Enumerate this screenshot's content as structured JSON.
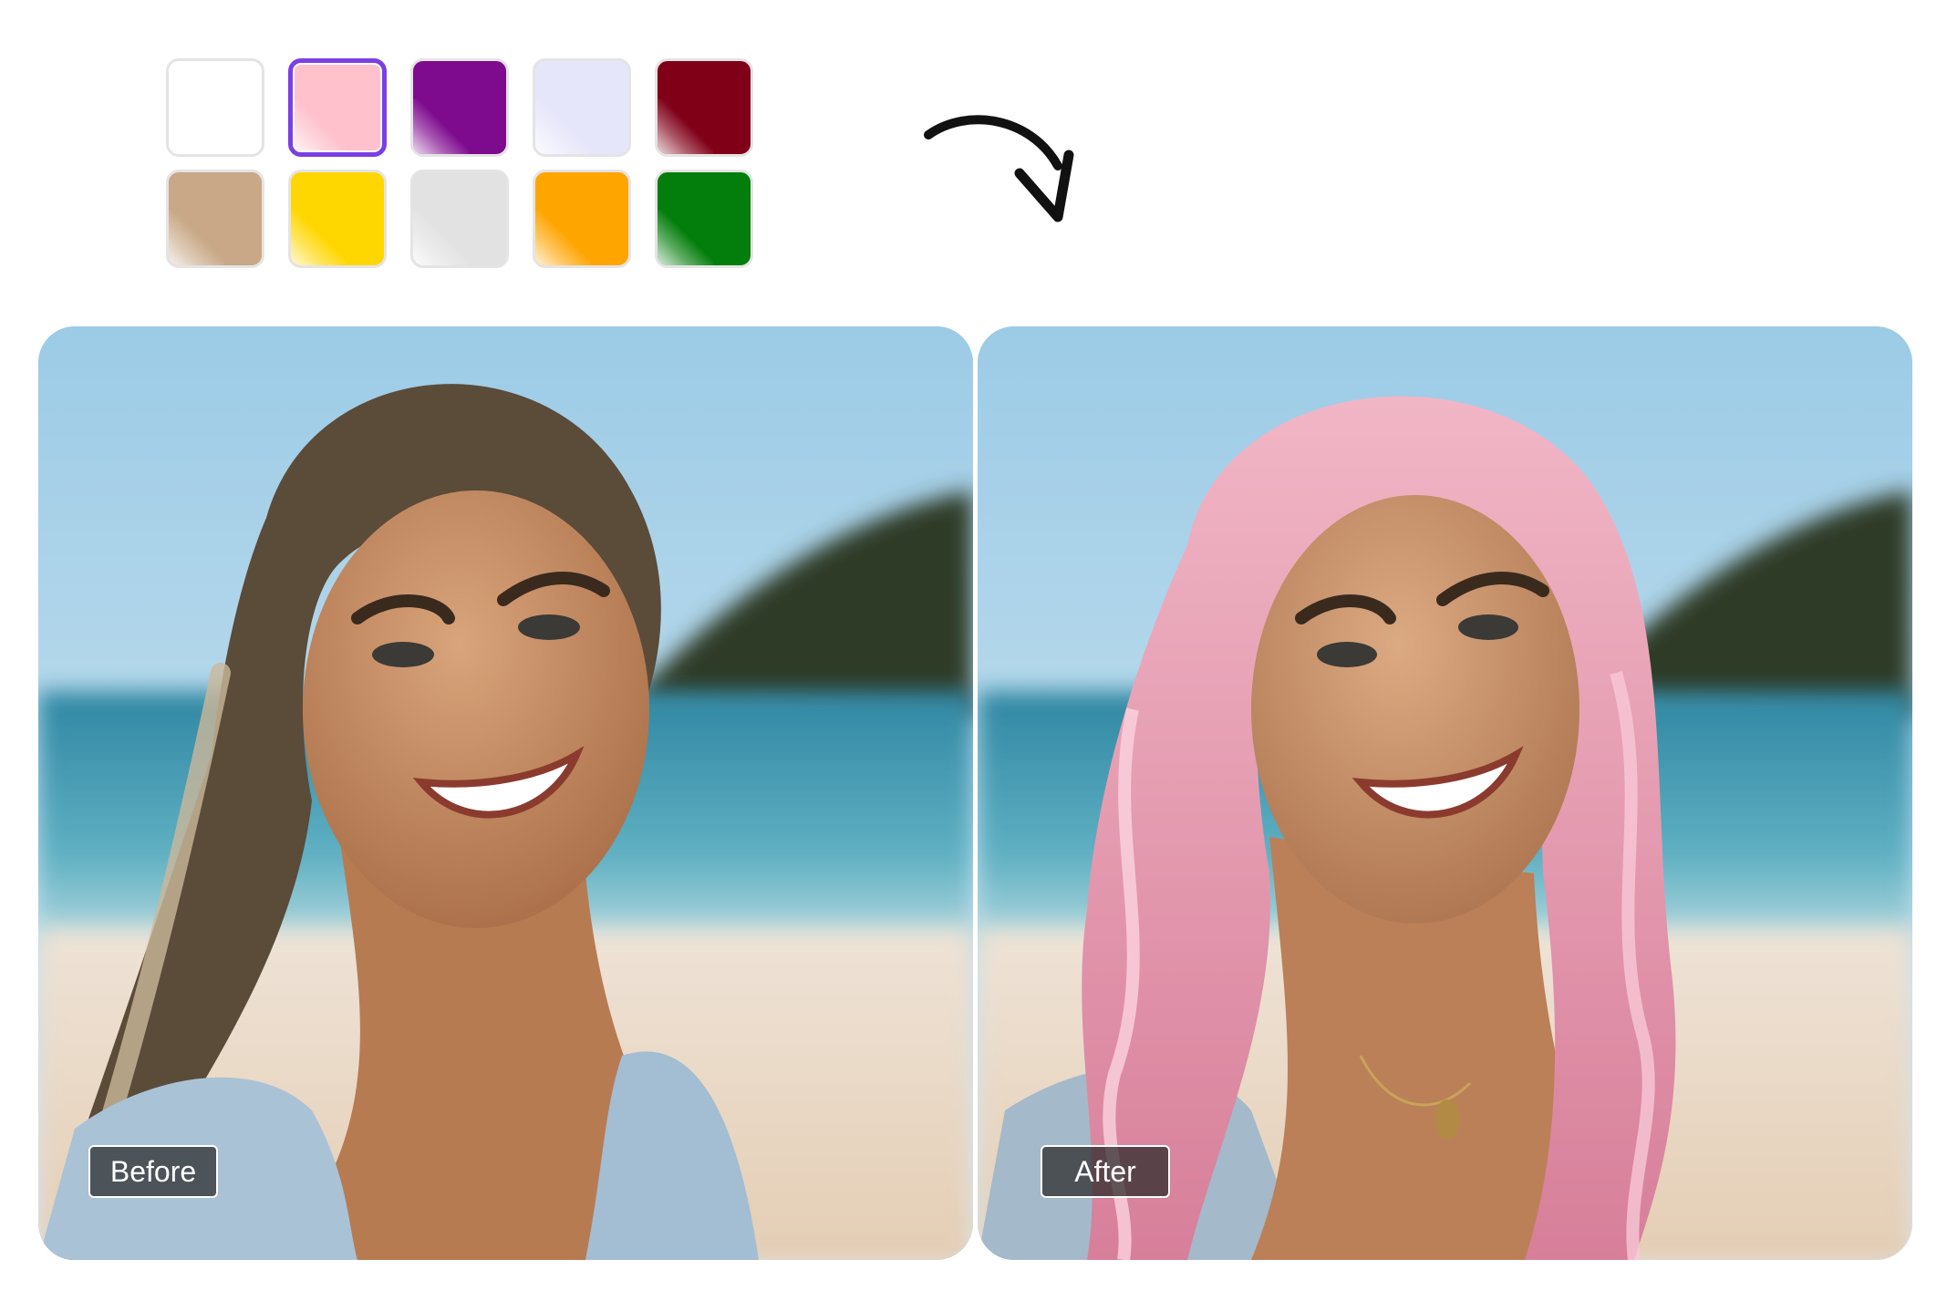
{
  "palette": {
    "swatches": [
      {
        "name": "white",
        "color": "#ffffff",
        "selected": false
      },
      {
        "name": "pink",
        "color": "#ffc1cc",
        "selected": true
      },
      {
        "name": "purple",
        "color": "#7e0a8e",
        "selected": false
      },
      {
        "name": "lavender",
        "color": "#e6e6fa",
        "selected": false
      },
      {
        "name": "maroon",
        "color": "#800018",
        "selected": false
      },
      {
        "name": "tan",
        "color": "#c8a886",
        "selected": false
      },
      {
        "name": "yellow",
        "color": "#ffd700",
        "selected": false
      },
      {
        "name": "light-gray",
        "color": "#e2e2e2",
        "selected": false
      },
      {
        "name": "orange",
        "color": "#ffa500",
        "selected": false
      },
      {
        "name": "green",
        "color": "#037d0b",
        "selected": false
      }
    ],
    "selected_border_color": "#7b3fe4"
  },
  "comparison": {
    "before_label": "Before",
    "after_label": "After",
    "before_hair_color": "#6b5a45",
    "after_hair_color": "#eaa3b6"
  }
}
